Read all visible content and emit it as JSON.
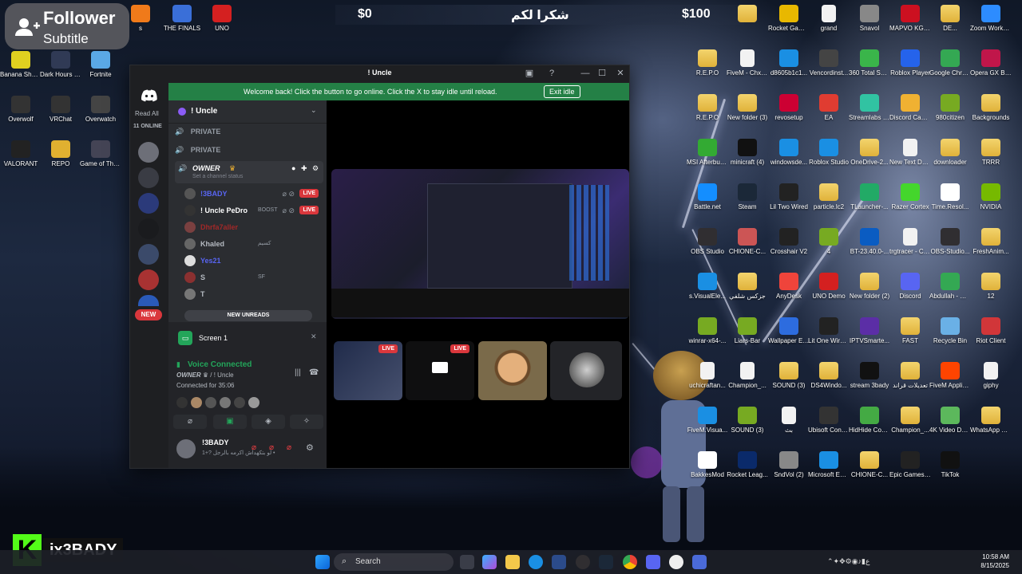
{
  "overlay": {
    "follower_title": "Follower",
    "follower_subtitle": "Subtitle",
    "stat_left": "$0",
    "stat_mid": "شكرا لكم",
    "stat_right": "$100",
    "channel_name": "ix3BADY",
    "kick_letter": "K"
  },
  "desktop_left": [
    {
      "label": "s",
      "color": "#f07a1a"
    },
    {
      "label": "THE FINALS",
      "color": "#3a6fd8"
    },
    {
      "label": "UNO",
      "color": "#d42020"
    },
    {
      "label": "Banana Shooter",
      "color": "#e0d020"
    },
    {
      "label": "Dark Hours Prologue",
      "color": "#303a55"
    },
    {
      "label": "Fortnite",
      "color": "#5aa8e6"
    },
    {
      "label": "Overwolf",
      "color": "#333"
    },
    {
      "label": "VRChat",
      "color": "#333"
    },
    {
      "label": "Overwatch",
      "color": "#444"
    },
    {
      "label": "VALORANT",
      "color": "#222"
    },
    {
      "label": "REPO",
      "color": "#e0b030"
    },
    {
      "label": "Game of Thrones...",
      "color": "#445"
    }
  ],
  "desktop_right": [
    {
      "label": "",
      "color": "folder"
    },
    {
      "label": "Rocket Games ...",
      "color": "#e8b800"
    },
    {
      "label": "grand",
      "color": "doc"
    },
    {
      "label": "Snavol",
      "color": "#888"
    },
    {
      "label": "MAPVO KG965...",
      "color": "#cc1020"
    },
    {
      "label": "DE...",
      "color": "folder"
    },
    {
      "label": "Zoom Workplace",
      "color": "#2d8cff"
    },
    {
      "label": "R.E.P.O",
      "color": "folder"
    },
    {
      "label": "FiveM - Chxre Devel...",
      "color": "doc"
    },
    {
      "label": "d8605b1c1...",
      "color": "#1a8fe3"
    },
    {
      "label": "Vencordinst...",
      "color": "#444"
    },
    {
      "label": "360 Total Security",
      "color": "#3ab54a"
    },
    {
      "label": "Roblox Player",
      "color": "#2563eb"
    },
    {
      "label": "Google Chrome",
      "color": "#34a853"
    },
    {
      "label": "Opera GX Browser",
      "color": "#c0164a"
    },
    {
      "label": "R.E.P.O",
      "color": "folder"
    },
    {
      "label": "New folder (3)",
      "color": "folder"
    },
    {
      "label": "revosetup",
      "color": "#c03"
    },
    {
      "label": "EA",
      "color": "#e03c31"
    },
    {
      "label": "Streamlabs Desktop",
      "color": "#31c3a2"
    },
    {
      "label": "Discord Canary",
      "color": "#f0b132"
    },
    {
      "label": "980citizen",
      "color": "#7a2"
    },
    {
      "label": "Backgrounds",
      "color": "folder"
    },
    {
      "label": "MSI Afterburner",
      "color": "#3a3"
    },
    {
      "label": "minicraft (4)",
      "color": "#111"
    },
    {
      "label": "windowsde...",
      "color": "#1a8fe3"
    },
    {
      "label": "Roblox Studio",
      "color": "#1a8fe3"
    },
    {
      "label": "OneDrive-2...",
      "color": "folder"
    },
    {
      "label": "New Text Document",
      "color": "doc"
    },
    {
      "label": "downloader",
      "color": "folder"
    },
    {
      "label": "TRRR",
      "color": "folder"
    },
    {
      "label": "Battle.net",
      "color": "#148eff"
    },
    {
      "label": "Steam",
      "color": "#1b2838"
    },
    {
      "label": "Lil Two Wired",
      "color": "#222"
    },
    {
      "label": "particle.lc2",
      "color": "folder"
    },
    {
      "label": "TLauncher-...",
      "color": "#2a6"
    },
    {
      "label": "Razer Cortex",
      "color": "#44d62c"
    },
    {
      "label": "Time.Resol...",
      "color": "#fff"
    },
    {
      "label": "NVIDIA",
      "color": "#76b900"
    },
    {
      "label": "OBS Studio",
      "color": "#302e31"
    },
    {
      "label": "CHIONE-C...",
      "color": "#c55"
    },
    {
      "label": "Crosshair V2",
      "color": "#222"
    },
    {
      "label": "4",
      "color": "#7a2"
    },
    {
      "label": "BT-23.40.0-...",
      "color": "#0a5cc2"
    },
    {
      "label": "trgtracer - Copy",
      "color": "doc"
    },
    {
      "label": "OBS-Studio...",
      "color": "#302e31"
    },
    {
      "label": "FreshAnim...",
      "color": "folder"
    },
    {
      "label": "s.VisualEle...",
      "color": "#1a8fe3"
    },
    {
      "label": "جزكس شلفي",
      "color": "folder"
    },
    {
      "label": "AnyDesk",
      "color": "#ef443b"
    },
    {
      "label": "UNO Demo",
      "color": "#d42020"
    },
    {
      "label": "New folder (2)",
      "color": "folder"
    },
    {
      "label": "Discord",
      "color": "#5865f2"
    },
    {
      "label": "Abdullah - Chrome",
      "color": "#34a853"
    },
    {
      "label": "12",
      "color": "folder"
    },
    {
      "label": "winrar-x64-...",
      "color": "#7a2"
    },
    {
      "label": "Liars-Bar",
      "color": "#7a2"
    },
    {
      "label": "Wallpaper Engine",
      "color": "#2d6cdf"
    },
    {
      "label": "Lit One Wireless",
      "color": "#222"
    },
    {
      "label": "IPTVSmarte...",
      "color": "#5b2ea6"
    },
    {
      "label": "FAST",
      "color": "folder"
    },
    {
      "label": "Recycle Bin",
      "color": "#6ab0e6"
    },
    {
      "label": "Riot Client",
      "color": "#d13639"
    },
    {
      "label": "uchicraftan...",
      "color": "doc"
    },
    {
      "label": "Champion_...",
      "color": "doc"
    },
    {
      "label": "SOUND (3)",
      "color": "folder"
    },
    {
      "label": "DS4Windo...",
      "color": "folder"
    },
    {
      "label": "stream 3bady",
      "color": "#111"
    },
    {
      "label": "تعديلات قراند",
      "color": "folder"
    },
    {
      "label": "FiveM Applicati...",
      "color": "#f40"
    },
    {
      "label": "giphy",
      "color": "doc"
    },
    {
      "label": "FiveM.Visua...",
      "color": "#1a8fe3"
    },
    {
      "label": "SOUND (3)",
      "color": "#7a2"
    },
    {
      "label": "بث",
      "color": "doc"
    },
    {
      "label": "Ubisoft Connect",
      "color": "#333"
    },
    {
      "label": "HidHide Configurat...",
      "color": "#4a4"
    },
    {
      "label": "Champion_...",
      "color": "folder"
    },
    {
      "label": "4K Video Downloader+",
      "color": "#5cb85c"
    },
    {
      "label": "WhatsApp Unknown 2...",
      "color": "folder"
    },
    {
      "label": "BakkesMod",
      "color": "#fff"
    },
    {
      "label": "Rocket Leag...",
      "color": "#0a2a6a"
    },
    {
      "label": "SndVol (2)",
      "color": "#888"
    },
    {
      "label": "Microsoft Edge",
      "color": "#1a8fe3"
    },
    {
      "label": "CHIONE-C...",
      "color": "folder"
    },
    {
      "label": "Epic Games Launcher",
      "color": "#222"
    },
    {
      "label": "TikTok",
      "color": "#111"
    }
  ],
  "discord": {
    "window_title": "! Uncle",
    "banner_text": "Welcome back! Click the button to go online. Click the X to stay idle until reload.",
    "exit_idle": "Exit idle",
    "read_all": "Read All",
    "online_count": "11 ONLINE",
    "new_label": "NEW",
    "server_name": "! Uncle",
    "channels": [
      {
        "name": "PRIVATE"
      },
      {
        "name": "PRIVATE"
      }
    ],
    "owner_channel": "OWNER",
    "channel_status": "Set a channel status",
    "members": [
      {
        "name": "!3BADY",
        "color": "#5865f2",
        "live": "LIVE"
      },
      {
        "name": "! Uncle PeDro",
        "color": "#ffffff",
        "live": "LIVE",
        "tag": "BOOST"
      },
      {
        "name": "Dhrfa7aller",
        "color": "#a12828",
        "live": ""
      },
      {
        "name": "Khaled",
        "color": "#b5bac1",
        "live": "",
        "tag": "كسيم"
      },
      {
        "name": "Yes21",
        "color": "#5865f2",
        "live": ""
      },
      {
        "name": "S",
        "color": "#b5bac1",
        "live": "",
        "tag": "SF"
      },
      {
        "name": "T",
        "color": "#b5bac1",
        "live": ""
      }
    ],
    "new_unreads": "NEW UNREADS",
    "screen_label": "Screen 1",
    "voice_connected": "Voice Connected",
    "voice_channel": "OWNER",
    "voice_server": "! Uncle",
    "connected_for": "Connected for 35:06",
    "user_name": "!3BADY",
    "user_status": "لو بتكهداش اكرمه بالرجل ?+1 •",
    "live_badge": "LIVE"
  },
  "taskbar": {
    "search": "Search",
    "time": "10:58 AM",
    "date": "8/15/2025"
  }
}
